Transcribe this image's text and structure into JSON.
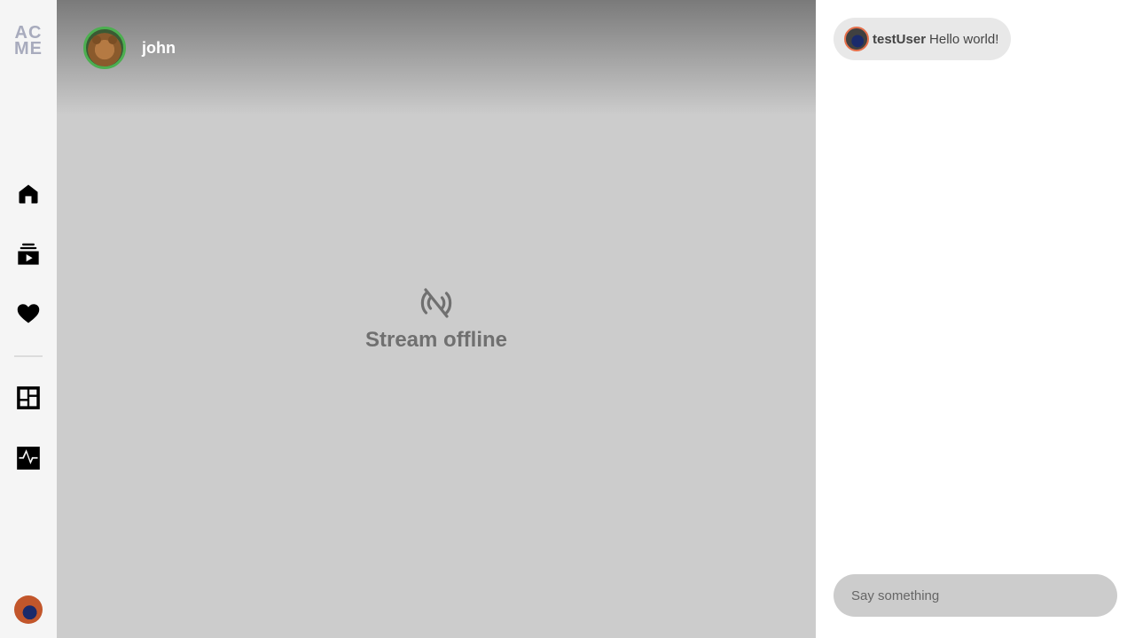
{
  "logo": {
    "line1": "AC",
    "line2": "ME"
  },
  "sidebar": {
    "items": [
      {
        "name": "home",
        "icon": "home-icon"
      },
      {
        "name": "subscriptions",
        "icon": "video-library-icon"
      },
      {
        "name": "favorites",
        "icon": "heart-icon"
      },
      {
        "name": "dashboard",
        "icon": "dashboard-icon"
      },
      {
        "name": "analytics",
        "icon": "pulse-icon"
      }
    ]
  },
  "stream": {
    "streamer_name": "john",
    "status_icon": "broadcast-off-icon",
    "status_text": "Stream offline"
  },
  "chat": {
    "messages": [
      {
        "user": "testUser",
        "text": "Hello world!"
      }
    ],
    "input_placeholder": "Say something"
  },
  "colors": {
    "accent_ring": "#4caf50",
    "chat_avatar_ring": "#e6704b",
    "sidebar_bg": "#f5f5f5",
    "stream_bg": "#cccccc",
    "offline_text": "#707070"
  }
}
